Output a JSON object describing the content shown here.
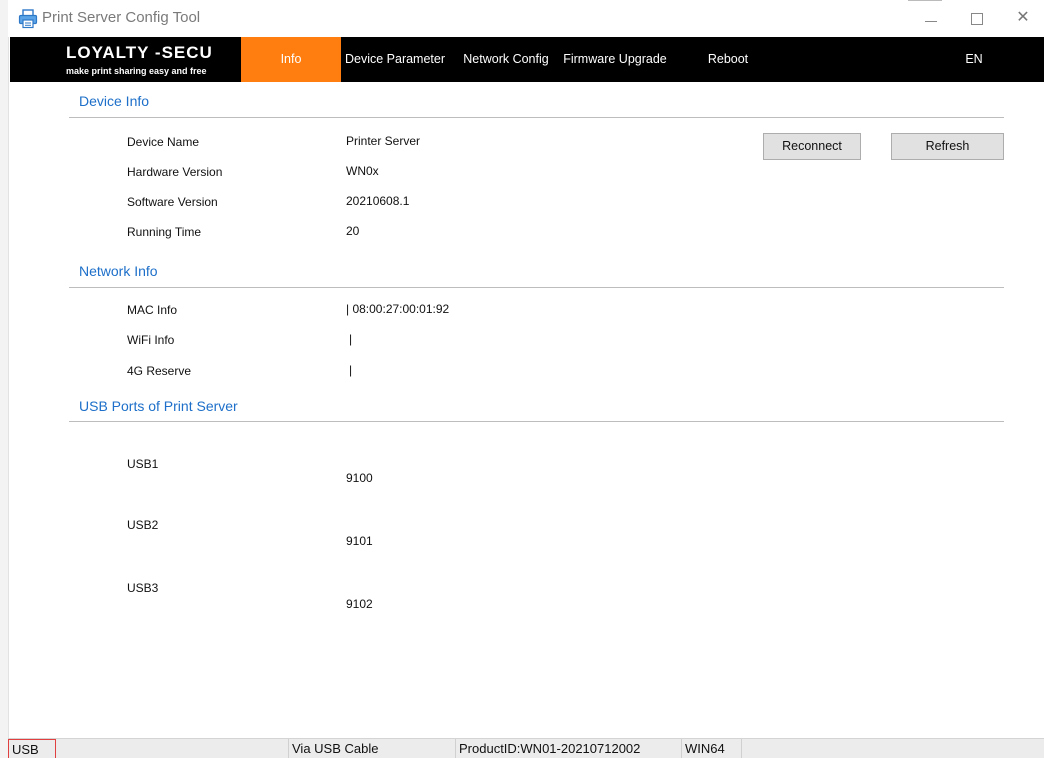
{
  "window": {
    "title": "Print Server Config Tool",
    "minimize_glyph": "",
    "maximize_glyph": "",
    "close_glyph": "✕"
  },
  "brand": {
    "name": "LOYALTY -SECU",
    "tagline": "make print sharing easy and free"
  },
  "nav": {
    "items": [
      {
        "label": "Info",
        "active": true
      },
      {
        "label": "Device Parameter",
        "active": false
      },
      {
        "label": "Network Config",
        "active": false
      },
      {
        "label": "Firmware Upgrade",
        "active": false
      },
      {
        "label": "Reboot",
        "active": false
      }
    ],
    "language": "EN"
  },
  "device_info": {
    "title": "Device Info",
    "rows": [
      {
        "label": "Device Name",
        "value": "Printer Server"
      },
      {
        "label": "Hardware Version",
        "value": "WN0x"
      },
      {
        "label": "Software Version",
        "value": "20210608.1"
      },
      {
        "label": "Running Time",
        "value": "20"
      }
    ],
    "reconnect_label": "Reconnect",
    "refresh_label": "Refresh"
  },
  "network_info": {
    "title": "Network Info",
    "rows": [
      {
        "label": "MAC Info",
        "value": "| 08:00:27:00:01:92"
      },
      {
        "label": "WiFi Info",
        "value": "|"
      },
      {
        "label": "4G Reserve",
        "value": "|"
      }
    ]
  },
  "usb_ports": {
    "title": "USB Ports of Print Server",
    "ports": [
      {
        "label": "USB1",
        "value": "9100"
      },
      {
        "label": "USB2",
        "value": "9101"
      },
      {
        "label": "USB3",
        "value": "9102"
      }
    ]
  },
  "status_bar": {
    "connection": "USB",
    "blank": "",
    "via": "Via USB Cable",
    "product_id": "ProductID:WN01-20210712002",
    "os": "WIN64"
  },
  "colors": {
    "accent": "#ff7e0f",
    "nav_background": "#000000",
    "section_title": "#1d6fc9"
  }
}
